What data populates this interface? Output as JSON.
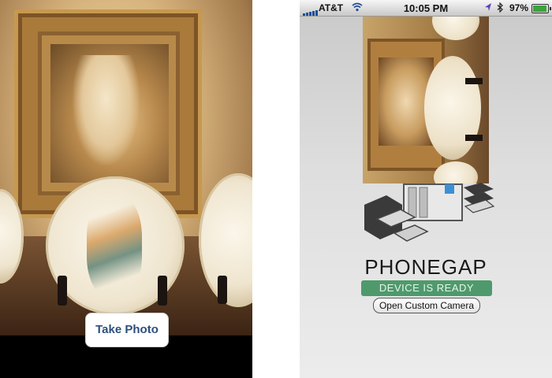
{
  "left_screen": {
    "take_photo_label": "Take Photo"
  },
  "right_screen": {
    "status_bar": {
      "carrier": "AT&T",
      "time": "10:05 PM",
      "battery_percent": "97%",
      "battery_level": 0.97,
      "icons": [
        "signal-bars-icon",
        "wifi-icon",
        "location-arrow-icon",
        "bluetooth-icon",
        "battery-icon"
      ]
    },
    "app_title": "PHONEGAP",
    "status_badge": "DEVICE IS READY",
    "open_camera_label": "Open Custom Camera",
    "colors": {
      "badge": "#4e9a6c",
      "status_bar": "#d8d8d8"
    }
  }
}
